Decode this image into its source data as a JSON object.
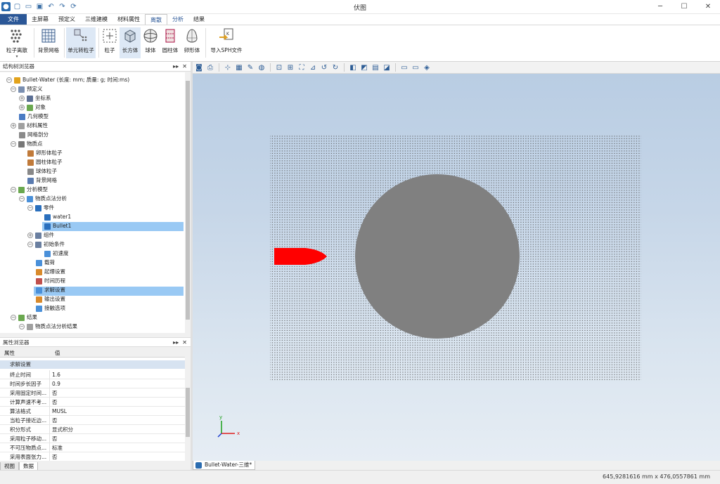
{
  "window": {
    "title": "伏图"
  },
  "menu": {
    "file": "文件",
    "tabs": [
      "主屏幕",
      "预定义",
      "三维建模",
      "材料属性",
      "离散",
      "分析",
      "结果"
    ]
  },
  "ribbon": {
    "buttons": [
      {
        "label": "粒子离散",
        "icon": "particle-discretize-icon"
      },
      {
        "label": "背景网格",
        "icon": "background-grid-icon"
      },
      {
        "label": "单元转粒子",
        "icon": "element-to-particle-icon"
      },
      {
        "label": "粒子",
        "icon": "particle-icon"
      },
      {
        "label": "长方体",
        "icon": "cuboid-icon"
      },
      {
        "label": "球体",
        "icon": "sphere-icon"
      },
      {
        "label": "圆柱体",
        "icon": "cylinder-icon"
      },
      {
        "label": "卵形体",
        "icon": "ovoid-icon"
      },
      {
        "label": "导入SPH文件",
        "icon": "import-sph-icon"
      }
    ]
  },
  "structure_browser": {
    "title": "结构树浏览器",
    "nodes": [
      {
        "label": "Bullet-Water (长度: mm; 质量: g; 时间:ms)",
        "icon": "model-icon",
        "color": "#e2a21b"
      },
      {
        "label": "预定义",
        "icon": "predefine-icon",
        "color": "#7a8fb0"
      },
      {
        "label": "坐标系",
        "icon": "coordinate-system-icon",
        "color": "#5b6f94"
      },
      {
        "label": "对象",
        "icon": "object-icon",
        "color": "#6aa84f"
      },
      {
        "label": "几何模型",
        "icon": "geometry-icon",
        "color": "#4a7bc4"
      },
      {
        "label": "材料属性",
        "icon": "material-icon",
        "color": "#a0a0a0"
      },
      {
        "label": "网格剖分",
        "icon": "mesh-icon",
        "color": "#8a8a8a"
      },
      {
        "label": "物质点",
        "icon": "material-point-icon",
        "color": "#777777"
      },
      {
        "label": "卵形体粒子",
        "icon": "ovoid-particle-icon",
        "color": "#c07a3a"
      },
      {
        "label": "圆柱体粒子",
        "icon": "cylinder-particle-icon",
        "color": "#c07a3a"
      },
      {
        "label": "球体粒子",
        "icon": "sphere-particle-icon",
        "color": "#888888"
      },
      {
        "label": "背景网格",
        "icon": "background-grid-icon",
        "color": "#5a7bb0"
      },
      {
        "label": "分析模型",
        "icon": "analysis-model-icon",
        "color": "#6aa84f"
      },
      {
        "label": "物质点法分析",
        "icon": "mpm-analysis-icon",
        "color": "#4a90d9"
      },
      {
        "label": "零件",
        "icon": "part-icon",
        "color": "#2a6fbd"
      },
      {
        "label": "water1",
        "icon": "gear-icon",
        "color": "#2a6fbd"
      },
      {
        "label": "Bullet1",
        "icon": "gear-icon",
        "color": "#2a6fbd"
      },
      {
        "label": "组件",
        "icon": "assembly-icon",
        "color": "#6a7fa0"
      },
      {
        "label": "初始条件",
        "icon": "initial-condition-icon",
        "color": "#6a7fa0"
      },
      {
        "label": "初速度",
        "icon": "initial-velocity-icon",
        "color": "#4a90d9"
      },
      {
        "label": "载荷",
        "icon": "load-icon",
        "color": "#4a90d9"
      },
      {
        "label": "起爆设置",
        "icon": "detonation-icon",
        "color": "#d98a2b"
      },
      {
        "label": "时间历程",
        "icon": "time-history-icon",
        "color": "#c0504d"
      },
      {
        "label": "求解设置",
        "icon": "solve-settings-icon",
        "color": "#4a90d9"
      },
      {
        "label": "输出设置",
        "icon": "output-settings-icon",
        "color": "#d98a2b"
      },
      {
        "label": "接触选项",
        "icon": "contact-icon",
        "color": "#4a90d9"
      },
      {
        "label": "结果",
        "icon": "results-icon",
        "color": "#6aa84f"
      },
      {
        "label": "物质点法分析结果",
        "icon": "mpm-result-icon",
        "color": "#a0a0a0"
      }
    ]
  },
  "property_browser": {
    "title": "属性浏览器",
    "col_property": "属性",
    "col_value": "值",
    "group": "求解设置",
    "rows": [
      {
        "key": "终止时间",
        "value": "1.6"
      },
      {
        "key": "时间步长因子",
        "value": "0.9"
      },
      {
        "key": "采用固定时间...",
        "value": "否"
      },
      {
        "key": "计算声速不考...",
        "value": "否"
      },
      {
        "key": "算法格式",
        "value": "MUSL"
      },
      {
        "key": "当粒子接近边...",
        "value": "否"
      },
      {
        "key": "积分形式",
        "value": "显式积分"
      },
      {
        "key": "采用粒子移动...",
        "value": "否"
      },
      {
        "key": "不可压物质点...",
        "value": "标准"
      },
      {
        "key": "采用表面张力...",
        "value": "否"
      }
    ]
  },
  "bottom_tabs": [
    "视图",
    "数据"
  ],
  "document_tab": "Bullet-Water-三维*",
  "status": {
    "coordinates": "645,9281616 mm x 476,0557861 mm"
  },
  "axes": {
    "x": "x",
    "y": "y"
  },
  "scene_colors": {
    "background_top": "#b9cde3",
    "water_disk": "#808080",
    "bullet": "#ff0000",
    "particle_grid": "#555555"
  }
}
